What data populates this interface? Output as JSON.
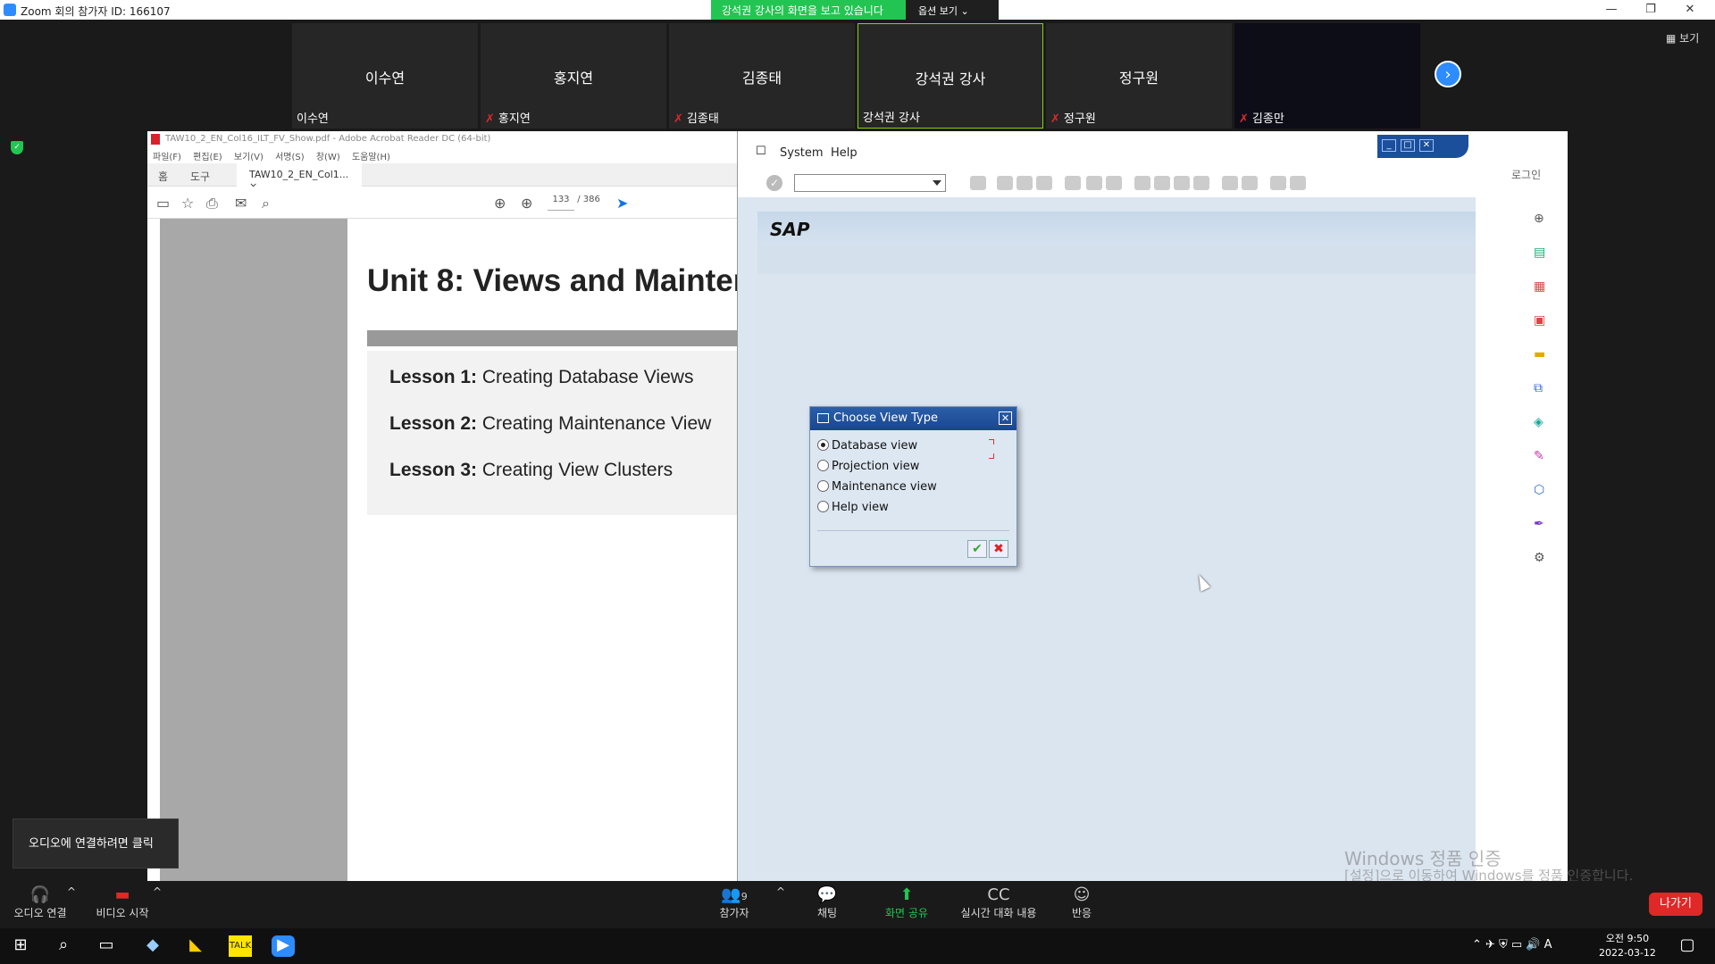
{
  "zoom": {
    "window_title": "Zoom 회의 참가자 ID: 166107",
    "share_banner": "강석권 강사의 화면을 보고 있습니다",
    "options_label": "옵션 보기 ⌄",
    "view_label": "보기",
    "participants": [
      {
        "center": "이수연",
        "bottom": "이수연",
        "muted": false
      },
      {
        "center": "홍지연",
        "bottom": "홍지연",
        "muted": true
      },
      {
        "center": "김종태",
        "bottom": "김종태",
        "muted": true
      },
      {
        "center": "강석권 강사",
        "bottom": "강석권 강사",
        "muted": false
      },
      {
        "center": "정구원",
        "bottom": "정구원",
        "muted": true
      },
      {
        "center": "",
        "bottom": "김종만",
        "muted": true
      }
    ],
    "audio_tip": "오디오에 연결하려면 클릭",
    "bottom": {
      "audio": "오디오 연결",
      "video": "비디오 시작",
      "participants": "참가자",
      "participants_count": "9",
      "chat": "채팅",
      "share": "화면 공유",
      "captions": "실시간 대화 내용",
      "reactions": "반응",
      "leave": "나가기"
    }
  },
  "acrobat": {
    "title": "TAW10_2_EN_Col16_ILT_FV_Show.pdf - Adobe Acrobat Reader DC (64-bit)",
    "menu": [
      "파일(F)",
      "편집(E)",
      "보기(V)",
      "서명(S)",
      "창(W)",
      "도움말(H)"
    ],
    "tab_home": "홈",
    "tab_tools": "도구",
    "doc_tab": "TAW10_2_EN_Col1...",
    "page_current": "133",
    "page_total": "/ 386",
    "unit_title": "Unit 8: Views and Mainter",
    "lessons": [
      {
        "label": "Lesson 1:",
        "text": " Creating Database Views"
      },
      {
        "label": "Lesson 2:",
        "text": " Creating Maintenance View"
      },
      {
        "label": "Lesson 3:",
        "text": " Creating View Clusters"
      }
    ],
    "login": "로그인"
  },
  "sap": {
    "menu": [
      "System",
      "Help"
    ],
    "logo": "SAP",
    "dialog": {
      "title": "Choose View Type",
      "options": [
        "Database view",
        "Projection view",
        "Maintenance view",
        "Help view"
      ],
      "selected_index": 0
    }
  },
  "windows": {
    "watermark_title": "Windows 정품 인증",
    "watermark_sub": "[설정]으로 이동하여 Windows를 정품 인증합니다.",
    "time": "오전 9:50",
    "date": "2022-03-12"
  }
}
